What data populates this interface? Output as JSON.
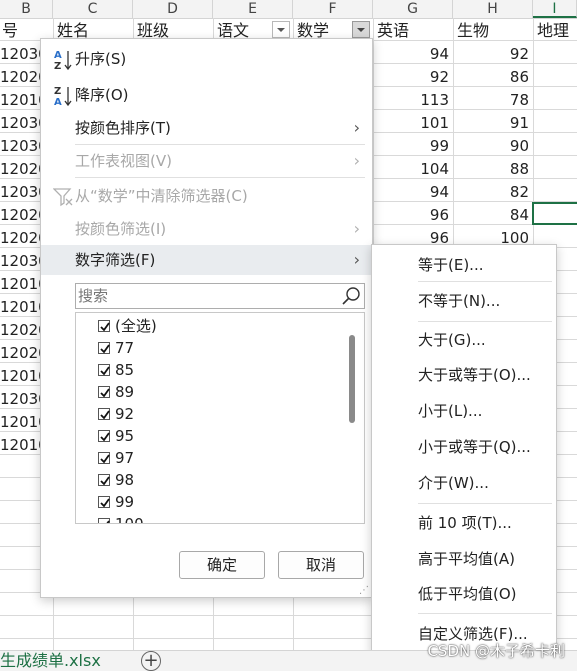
{
  "columns": {
    "letters": [
      "B",
      "C",
      "D",
      "E",
      "F",
      "G",
      "H",
      "I"
    ],
    "active": "I"
  },
  "headers": [
    "号",
    "姓名",
    "班级",
    "语文",
    "数学",
    "英语",
    "生物",
    "地理"
  ],
  "column_b_values": [
    "12030",
    "12020",
    "12010",
    "12030",
    "12030",
    "12020",
    "12030",
    "12020",
    "12020",
    "12030",
    "12010",
    "12010",
    "12020",
    "12020",
    "12010",
    "12030",
    "12010",
    "12010"
  ],
  "column_g_values": [
    94,
    92,
    113,
    101,
    99,
    104,
    94,
    96,
    96
  ],
  "column_h_values": [
    92,
    86,
    78,
    91,
    90,
    88,
    82,
    84,
    100
  ],
  "menu": {
    "sort_asc": "升序(S)",
    "sort_desc": "降序(O)",
    "sort_by_color": "按颜色排序(T)",
    "sheet_view": "工作表视图(V)",
    "clear_filter": "从“数学”中清除筛选器(C)",
    "filter_by_color": "按颜色筛选(I)",
    "number_filters": "数字筛选(F)",
    "search_placeholder": "搜索",
    "values": [
      "(全选)",
      "77",
      "85",
      "89",
      "92",
      "95",
      "97",
      "98",
      "99",
      "100"
    ],
    "ok": "确定",
    "cancel": "取消"
  },
  "submenu": {
    "items": [
      "等于(E)...",
      "不等于(N)...",
      "大于(G)...",
      "大于或等于(O)...",
      "小于(L)...",
      "小于或等于(Q)...",
      "介于(W)...",
      "前 10 项(T)...",
      "高于平均值(A)",
      "低于平均值(O)",
      "自定义筛选(F)..."
    ]
  },
  "sheet_tab": "生成绩单.xlsx",
  "add_sheet": "+",
  "watermark": "CSDN @木子希卡利",
  "colors": {
    "excel_green": "#1e7145",
    "header_bg": "#f3f3f3",
    "grid_line": "#d4d4d4"
  }
}
